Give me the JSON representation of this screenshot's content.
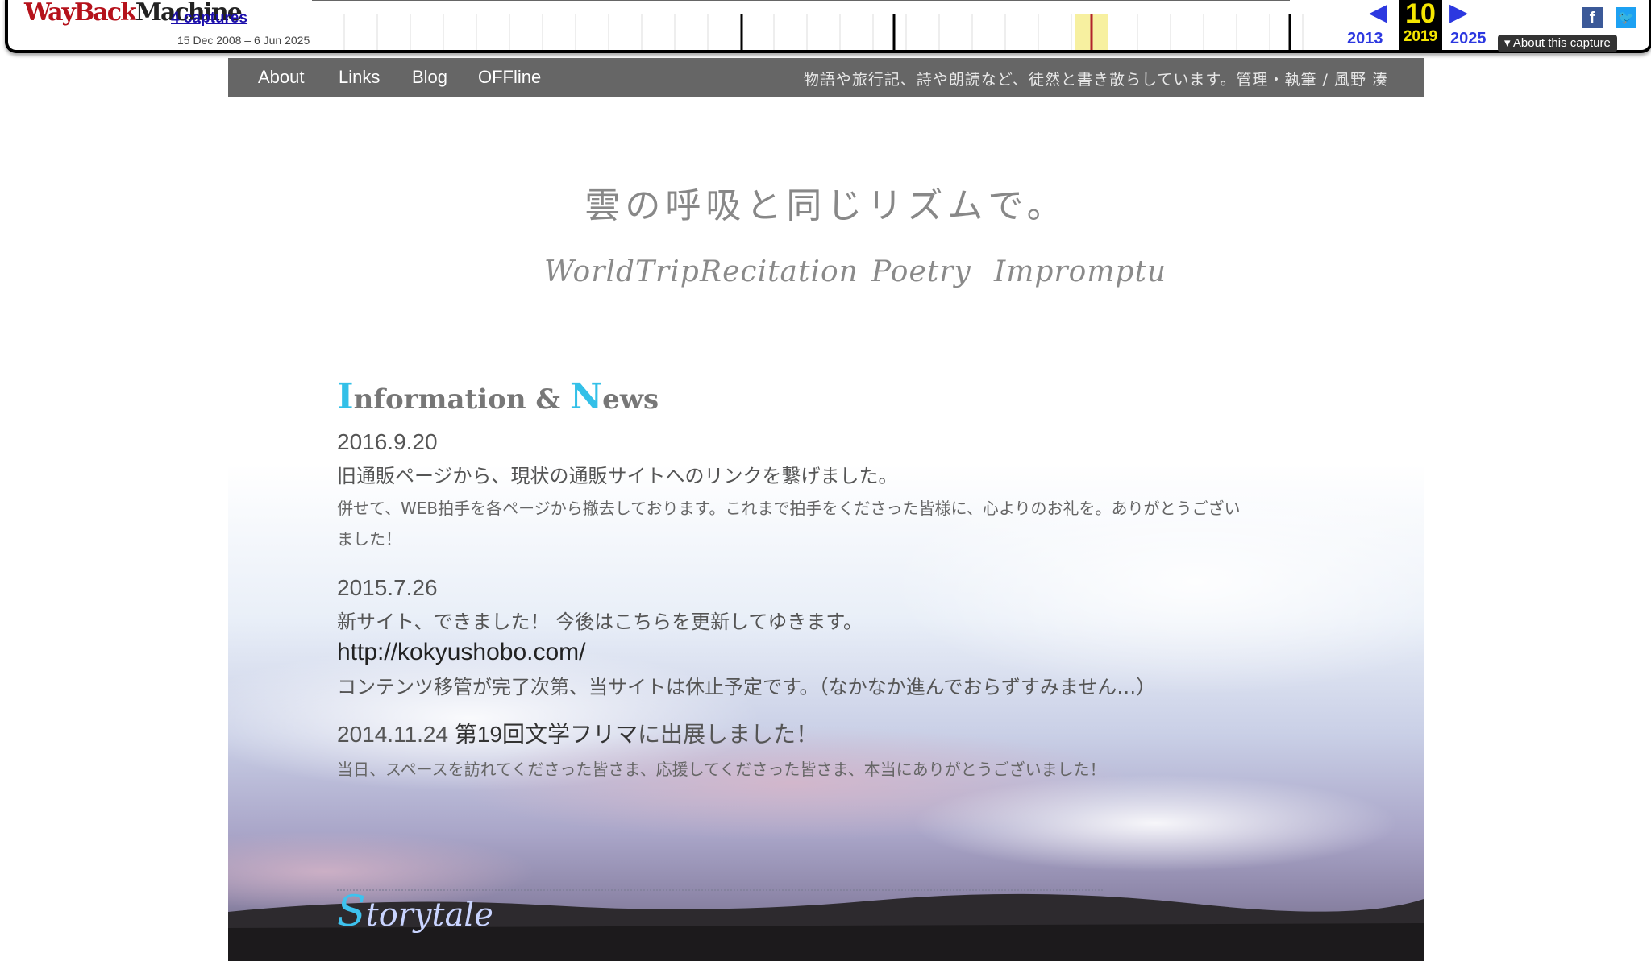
{
  "wayback": {
    "logo_part1": "WayBack",
    "logo_part2": "Machine",
    "captures": "4 captures",
    "date_range": "15 Dec 2008 – 6 Jun 2025",
    "prev_year": "2013",
    "current_month": "10",
    "current_year": "2019",
    "next_year": "2025",
    "about_capture": "About this capture",
    "prev_icon": "triangle-left-icon",
    "next_icon": "triangle-right-icon",
    "highlight_color": "#f5e600",
    "link_color": "#2c38e0"
  },
  "nav": {
    "items": [
      "About",
      "Links",
      "Blog",
      "OFFline"
    ],
    "tagline": "物語や旅行記、詩や朗読など、徒然と書き散らしています。管理・執筆 / 風野 湊"
  },
  "site_title": "雲の呼吸と同じリズムで。",
  "categories": [
    "WorldTrip",
    "Recitation",
    "Poetry",
    "Impromptu"
  ],
  "news": {
    "heading_i": "I",
    "heading_mid": "nformation & ",
    "heading_n": "N",
    "heading_end": "ews",
    "entries": [
      {
        "date": "2016.9.20",
        "title": "旧通販ページから、現状の通販サイトへのリンクを繋げました。",
        "body": "併せて、WEB拍手を各ページから撤去しております。これまで拍手をくださった皆様に、心よりのお礼を。ありがとうござい\nました！"
      },
      {
        "date": "2015.7.26",
        "title": "新サイト、できました！ 今後はこちらを更新してゆきます。",
        "url": "http://kokyushobo.com/",
        "body": "コンテンツ移管が完了次第、当サイトは休止予定です。（なかなか進んでおらずすみません…）"
      },
      {
        "date": "2014.11.24",
        "highlight": "第19回文学フリマ",
        "title_rest": "に出展しました！",
        "body": "当日、スペースを訪れてくださった皆さま、応援してくださった皆さま、本当にありがとうございました！"
      }
    ]
  },
  "footer_logo_cap": "S",
  "footer_logo_rest": "torytale"
}
